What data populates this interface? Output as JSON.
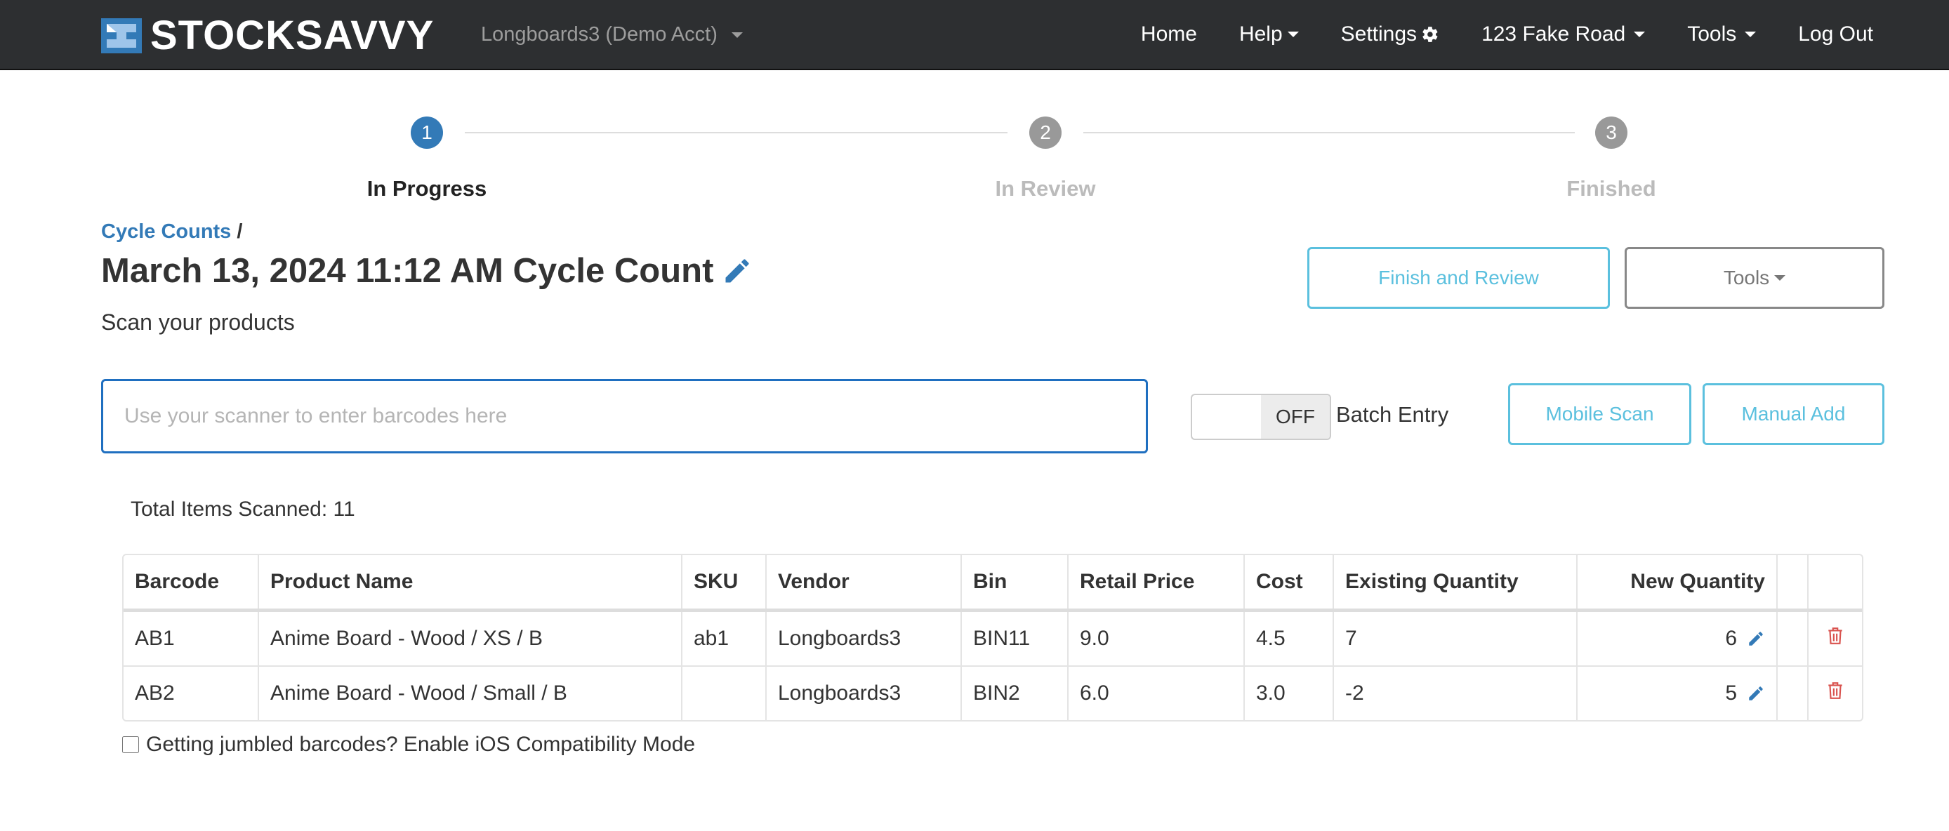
{
  "navbar": {
    "brand": "STOCKSAVVY",
    "account": "Longboards3 (Demo Acct)",
    "links": {
      "home": "Home",
      "help": "Help",
      "settings": "Settings",
      "location": "123 Fake Road",
      "tools": "Tools",
      "logout": "Log Out"
    }
  },
  "stepper": {
    "steps": [
      {
        "number": "1",
        "label": "In Progress"
      },
      {
        "number": "2",
        "label": "In Review"
      },
      {
        "number": "3",
        "label": "Finished"
      }
    ],
    "colors": {
      "active": "#337ab7",
      "inactive": "#999999",
      "inactive_label": "#bbbbbb"
    }
  },
  "header": {
    "breadcrumb_link": "Cycle Counts",
    "breadcrumb_sep": "/",
    "title": "March 13, 2024 11:12 AM Cycle Count",
    "subtitle": "Scan your products",
    "finish_button": "Finish and Review",
    "tools_button": "Tools"
  },
  "scan": {
    "placeholder": "Use your scanner to enter barcodes here",
    "toggle_state": "OFF",
    "batch_label": "Batch Entry",
    "mobile_scan": "Mobile Scan",
    "manual_add": "Manual Add"
  },
  "summary": {
    "total_label": "Total Items Scanned: 11"
  },
  "table": {
    "headers": {
      "barcode": "Barcode",
      "product": "Product Name",
      "sku": "SKU",
      "vendor": "Vendor",
      "bin": "Bin",
      "retail": "Retail Price",
      "cost": "Cost",
      "existing": "Existing Quantity",
      "newqty": "New Quantity"
    },
    "rows": [
      {
        "barcode": "AB1",
        "product": "Anime Board - Wood / XS / B",
        "sku": "ab1",
        "vendor": "Longboards3",
        "bin": "BIN11",
        "retail": "9.0",
        "cost": "4.5",
        "existing": "7",
        "newqty": "6"
      },
      {
        "barcode": "AB2",
        "product": "Anime Board - Wood / Small / B",
        "sku": "",
        "vendor": "Longboards3",
        "bin": "BIN2",
        "retail": "6.0",
        "cost": "3.0",
        "existing": "-2",
        "newqty": "5"
      }
    ]
  },
  "footer": {
    "ios_label": "Getting jumbled barcodes? Enable iOS Compatibility Mode"
  },
  "icons": {
    "brand_logo": "stocksavvy-logo-icon",
    "settings": "gear-icon",
    "edit": "pencil-icon",
    "delete": "trash-icon"
  },
  "colors": {
    "navbar": "#2d2f31",
    "link": "#337ab7",
    "info": "#5bc0de",
    "danger": "#d9534f"
  }
}
